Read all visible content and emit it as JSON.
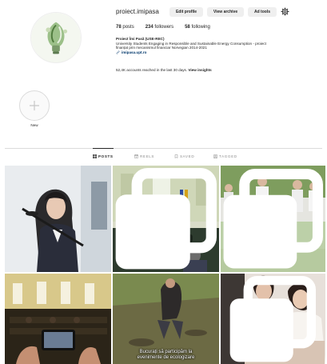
{
  "profile": {
    "username": "proiect.imipasa",
    "edit_profile_label": "Edit profile",
    "view_archive_label": "View archive",
    "ad_tools_label": "Ad tools",
    "stats": {
      "posts_count": "78",
      "posts_label": "posts",
      "followers_count": "234",
      "followers_label": "followers",
      "following_count": "58",
      "following_label": "following"
    },
    "bio": {
      "name": "Proiect Îmi Pasă (USE-REC)",
      "line1": "University Students Engaging in Responsible and Sustainable Energy Consumption - proiect",
      "line2": "finanțat prin mecanismul financiar Norvegian 2014-2021",
      "link": "imipasa.upt.ro"
    },
    "insights_text": "52,4K accounts reached in the last 30 days.",
    "insights_link": "View insights"
  },
  "highlights": [
    {
      "label": "New"
    }
  ],
  "tabs": [
    {
      "label": "POSTS",
      "active": true
    },
    {
      "label": "REELS",
      "active": false
    },
    {
      "label": "SAVED",
      "active": false
    },
    {
      "label": "TAGGED",
      "active": false
    }
  ],
  "posts": {
    "overlay_caption_line1": "Bucurați să participăm la",
    "overlay_caption_line2": "evenimente de ecologizare"
  },
  "colors": {
    "button_bg": "#efefef",
    "link": "#00376b",
    "divider": "#dbdbdb",
    "muted_text": "#8e8e8e"
  },
  "icons": {
    "settings": "gear-icon",
    "link": "link-icon",
    "add": "plus-icon",
    "posts_tab": "grid-icon",
    "reels_tab": "reels-icon",
    "saved_tab": "bookmark-icon",
    "tagged_tab": "tag-icon",
    "multi_post": "carousel-icon"
  }
}
